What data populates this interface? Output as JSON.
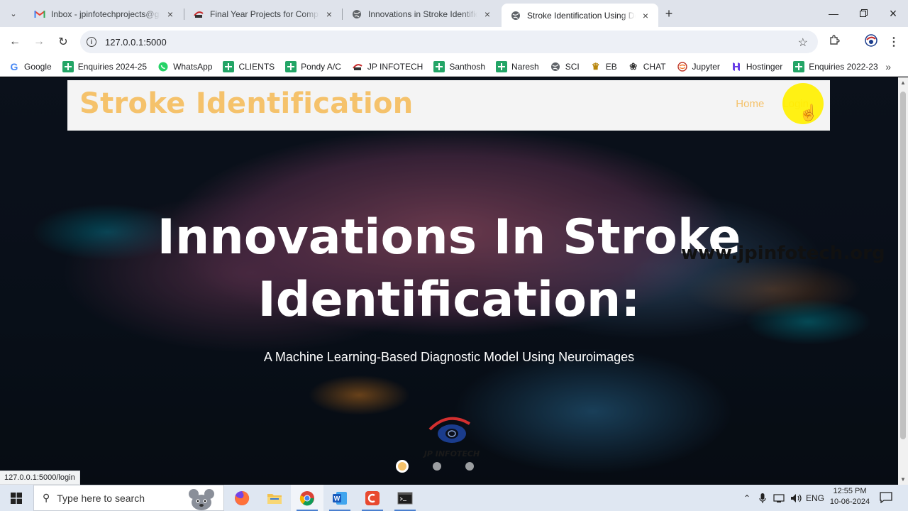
{
  "browser": {
    "tabs": [
      {
        "title": "Inbox - jpinfotechprojects@gmail.com",
        "favicon": "gmail-icon"
      },
      {
        "title": "Final Year Projects for Computer Science",
        "favicon": "jp-infotech-icon"
      },
      {
        "title": "Innovations in Stroke Identification",
        "favicon": "globe-icon"
      },
      {
        "title": "Stroke Identification Using Deep Learning",
        "favicon": "globe-icon",
        "active": true
      }
    ],
    "url": "127.0.0.1:5000",
    "status_url": "127.0.0.1:5000/login"
  },
  "bookmarks": [
    {
      "label": "Google",
      "icon": "google-icon"
    },
    {
      "label": "Enquiries 2024-25",
      "icon": "sheets-icon"
    },
    {
      "label": "WhatsApp",
      "icon": "whatsapp-icon"
    },
    {
      "label": "CLIENTS",
      "icon": "sheets-icon"
    },
    {
      "label": "Pondy A/C",
      "icon": "sheets-icon"
    },
    {
      "label": "JP INFOTECH",
      "icon": "jp-infotech-icon"
    },
    {
      "label": "Santhosh",
      "icon": "sheets-icon"
    },
    {
      "label": "Naresh",
      "icon": "sheets-icon"
    },
    {
      "label": "SCI",
      "icon": "globe-icon"
    },
    {
      "label": "EB",
      "icon": "emblem-icon"
    },
    {
      "label": "CHAT",
      "icon": "openai-icon"
    },
    {
      "label": "Jupyter",
      "icon": "jupyter-icon"
    },
    {
      "label": "Hostinger",
      "icon": "hostinger-icon"
    },
    {
      "label": "Enquiries 2022-23",
      "icon": "sheets-icon"
    }
  ],
  "site": {
    "brand": "Stroke Identification",
    "nav": [
      {
        "label": "Home"
      },
      {
        "label": "Login"
      }
    ],
    "hero_title_line1": "Innovations In Stroke",
    "hero_title_line2": "Identification:",
    "hero_subtitle": "A Machine Learning-Based Diagnostic Model Using Neuroimages",
    "watermark": "www.jpinfotech.org",
    "logo_text": "JP INFOTECH",
    "carousel": {
      "slides": 3,
      "active": 1
    }
  },
  "taskbar": {
    "search_placeholder": "Type here to search",
    "language": "ENG",
    "time": "12:55 PM",
    "date": "10-06-2024"
  },
  "colors": {
    "accent": "#f5c26b",
    "header_bg": "#f4f4f4",
    "highlight": "#ffef00"
  }
}
